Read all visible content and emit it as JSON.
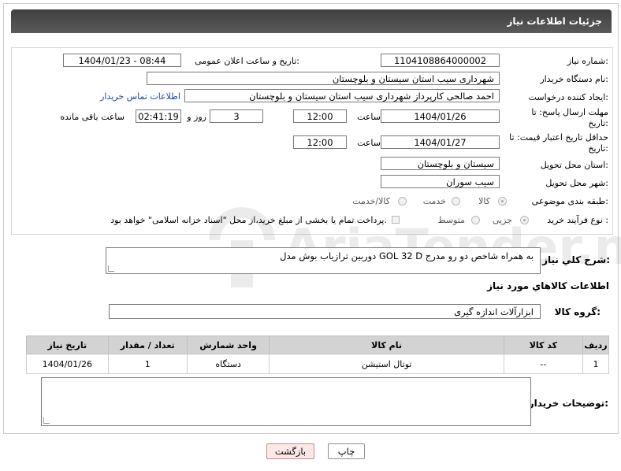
{
  "header": {
    "title": "جزئیات اطلاعات نیاز"
  },
  "form": {
    "need_number_label": "شماره نیاز:",
    "need_number": "1104108864000002",
    "announce_label": "تاریخ و ساعت اعلان عمومی:",
    "announce_value": "1404/01/23 - 08:44",
    "buyer_org_label": "نام دستگاه خریدار:",
    "buyer_org": "شهرداری سیب استان سیستان و بلوچستان",
    "creator_label": "ایجاد کننده درخواست:",
    "creator": "احمد صالحی کارپرداز  شهرداری سیب استان سیستان و بلوچستان",
    "contact_link": "اطلاعات تماس خریدار",
    "reply_deadline_label": "مهلت ارسال پاسخ: تا تاریخ:",
    "reply_date": "1404/01/26",
    "time_label": "ساعت",
    "reply_time": "12:00",
    "days_value": "3",
    "days_label": "روز و",
    "remaining_time": "02:41:19",
    "remaining_label": "ساعت باقی مانده",
    "price_validity_label": "حداقل تاریخ اعتبار قیمت: تا تاریخ:",
    "price_date": "1404/01/27",
    "price_time": "12:00",
    "province_label": "استان محل تحویل:",
    "province": "سیستان و بلوچستان",
    "city_label": "شهر محل تحویل:",
    "city": "سیب سوران",
    "category_label": "طبقه بندی موضوعی:",
    "category_options": [
      "کالا",
      "خدمت",
      "کالا/خدمت"
    ],
    "category_selected": "کالا",
    "process_label": "نوع فرآیند خرید :",
    "process_options": [
      "جزیی",
      "متوسط"
    ],
    "process_selected": "جزیی",
    "payment_note": "پرداخت تمام یا بخشی از مبلغ خرید،از محل \"اسناد خزانه اسلامی\" خواهد بود."
  },
  "summary": {
    "label": "شرح کلي نياز:",
    "text": "دوربین ترازیاب بوش مدل GOL 32 D به همراه شاخص دو رو مدرج"
  },
  "goods": {
    "section_title": "اطلاعات کالاهاي مورد نياز",
    "group_label": "گروه کالا:",
    "group_value": "ابزارآلات اندازه گیری",
    "columns": [
      "ردیف",
      "کد کالا",
      "نام کالا",
      "واحد شمارش",
      "تعداد / مقدار",
      "تاریخ نیاز"
    ],
    "rows": [
      {
        "row": "1",
        "code": "--",
        "name": "توتال استیشن",
        "unit": "دستگاه",
        "qty": "1",
        "date": "1404/01/26"
      }
    ]
  },
  "buyer_notes": {
    "label": "توضیحات خریدار:",
    "value": ""
  },
  "buttons": {
    "print": "چاپ",
    "back": "بازگشت"
  },
  "watermark": {
    "text": "AriaTender.neT"
  },
  "colors": {
    "header_bg": "#4a4a4a",
    "link": "#1a48a8",
    "table_header_bg": "#d3d3d3",
    "back_button_bg": "#fde7e7"
  }
}
